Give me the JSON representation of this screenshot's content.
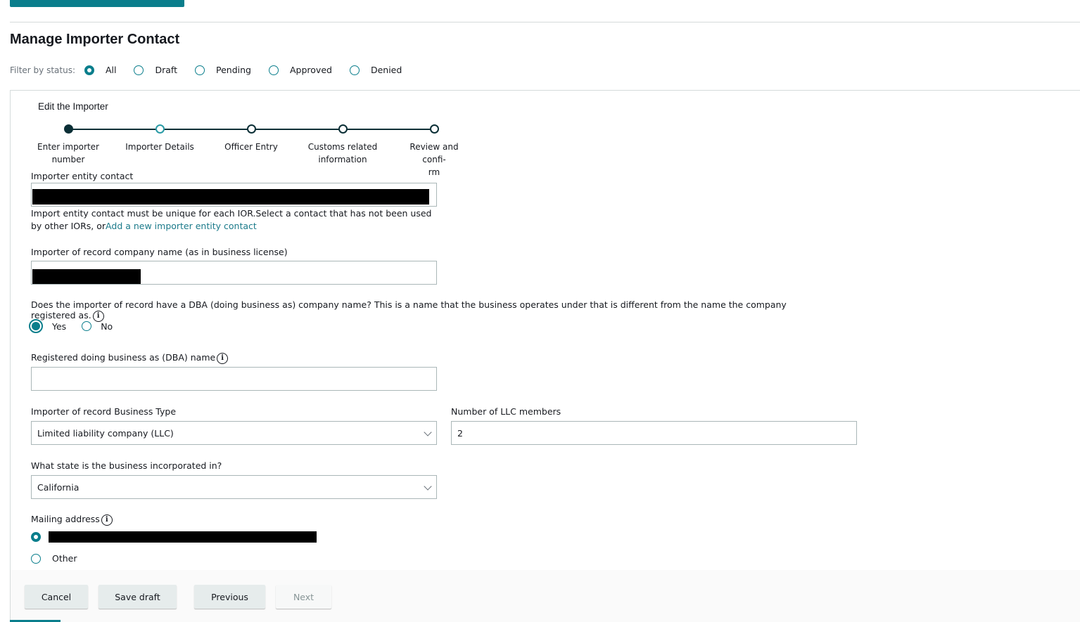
{
  "page": {
    "title": "Manage Importer Contact"
  },
  "filter": {
    "label": "Filter by status:",
    "options": [
      {
        "label": "All",
        "checked": true
      },
      {
        "label": "Draft",
        "checked": false
      },
      {
        "label": "Pending",
        "checked": false
      },
      {
        "label": "Approved",
        "checked": false
      },
      {
        "label": "Denied",
        "checked": false
      }
    ]
  },
  "panel": {
    "title": "Edit the Importer"
  },
  "stepper": {
    "steps": [
      {
        "label": "Enter importer number",
        "state": "done"
      },
      {
        "label": "Importer Details",
        "state": "current"
      },
      {
        "label": "Officer Entry",
        "state": "pending"
      },
      {
        "label": "Customs related information",
        "state": "pending"
      },
      {
        "label": "Review and confi-rm",
        "state": "pending"
      }
    ]
  },
  "form": {
    "entity_contact": {
      "label": "Importer entity contact",
      "value": "[redacted]",
      "hint": "Import entity contact must be unique for each IOR.Select a contact that has not been used by other IORs, or",
      "hint_link": "Add a new importer entity contact"
    },
    "company_name": {
      "label": "Importer of record company name (as in business license)",
      "value": "[redacted]"
    },
    "dba_question": {
      "label": "Does the importer of record have a DBA (doing business as) company name? This is a name that the business operates under that is different from the name the company registered as.",
      "options": [
        {
          "label": "Yes",
          "checked": true
        },
        {
          "label": "No",
          "checked": false
        }
      ],
      "info_icon": "info-icon"
    },
    "dba_name": {
      "label": "Registered doing business as (DBA) name",
      "value": "",
      "info_icon": "info-icon"
    },
    "business_type": {
      "label": "Importer of record Business Type",
      "value": "Limited liability company (LLC)"
    },
    "llc_members": {
      "label": "Number of LLC members",
      "value": "2"
    },
    "state": {
      "label": "What state is the business incorporated in?",
      "value": "California"
    },
    "mailing_address": {
      "label": "Mailing address",
      "info_icon": "info-icon",
      "options": [
        {
          "label": "[redacted]",
          "checked": true
        },
        {
          "label": "Other",
          "checked": false
        }
      ]
    }
  },
  "footer": {
    "cancel": "Cancel",
    "save_draft": "Save draft",
    "previous": "Previous",
    "next": "Next"
  },
  "colors": {
    "accent": "#0a7e8c",
    "stepper_dark": "#0b2f36",
    "link": "#1b7a8a"
  }
}
